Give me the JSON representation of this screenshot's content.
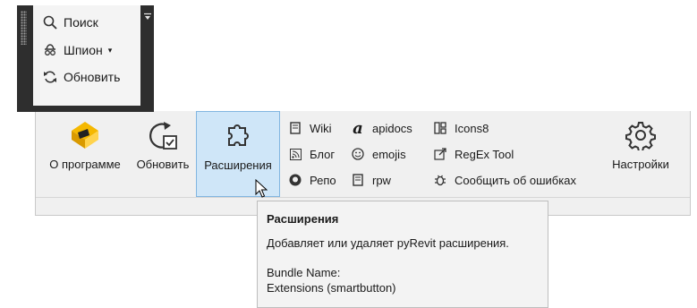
{
  "dock": {
    "items": [
      {
        "label": "Поиск",
        "icon": "search-icon"
      },
      {
        "label": "Шпион",
        "icon": "spy-icon",
        "dropdown": true
      },
      {
        "label": "Обновить",
        "icon": "refresh-icon"
      }
    ]
  },
  "ribbon": {
    "big_buttons": [
      {
        "label": "О программе",
        "icon": "pyrevit-logo-icon"
      },
      {
        "label": "Обновить",
        "icon": "update-icon"
      },
      {
        "label": "Расширения",
        "icon": "puzzle-icon"
      },
      {
        "label": "Настройки",
        "icon": "gear-icon"
      }
    ],
    "links": [
      {
        "label": "Wiki",
        "icon": "book-icon"
      },
      {
        "label": "Блог",
        "icon": "rss-icon"
      },
      {
        "label": "Репо",
        "icon": "github-icon"
      },
      {
        "label": "apidocs",
        "icon": "apidocs-icon"
      },
      {
        "label": "emojis",
        "icon": "smiley-icon"
      },
      {
        "label": "rpw",
        "icon": "book-icon"
      },
      {
        "label": "Icons8",
        "icon": "icons8-icon"
      },
      {
        "label": "RegEx Tool",
        "icon": "external-link-icon"
      },
      {
        "label": "Сообщить об ошибках",
        "icon": "bug-icon"
      }
    ]
  },
  "tooltip": {
    "title": "Расширения",
    "description": "Добавляет или удаляет pyRevit расширения.",
    "bundle_label": "Bundle Name:",
    "bundle_value": "Extensions (smartbutton)"
  },
  "colors": {
    "accent": "#f5b800",
    "active_bg": "#cfe6f8",
    "active_border": "#82b6e0",
    "dock_bg": "#2e2e2e"
  }
}
